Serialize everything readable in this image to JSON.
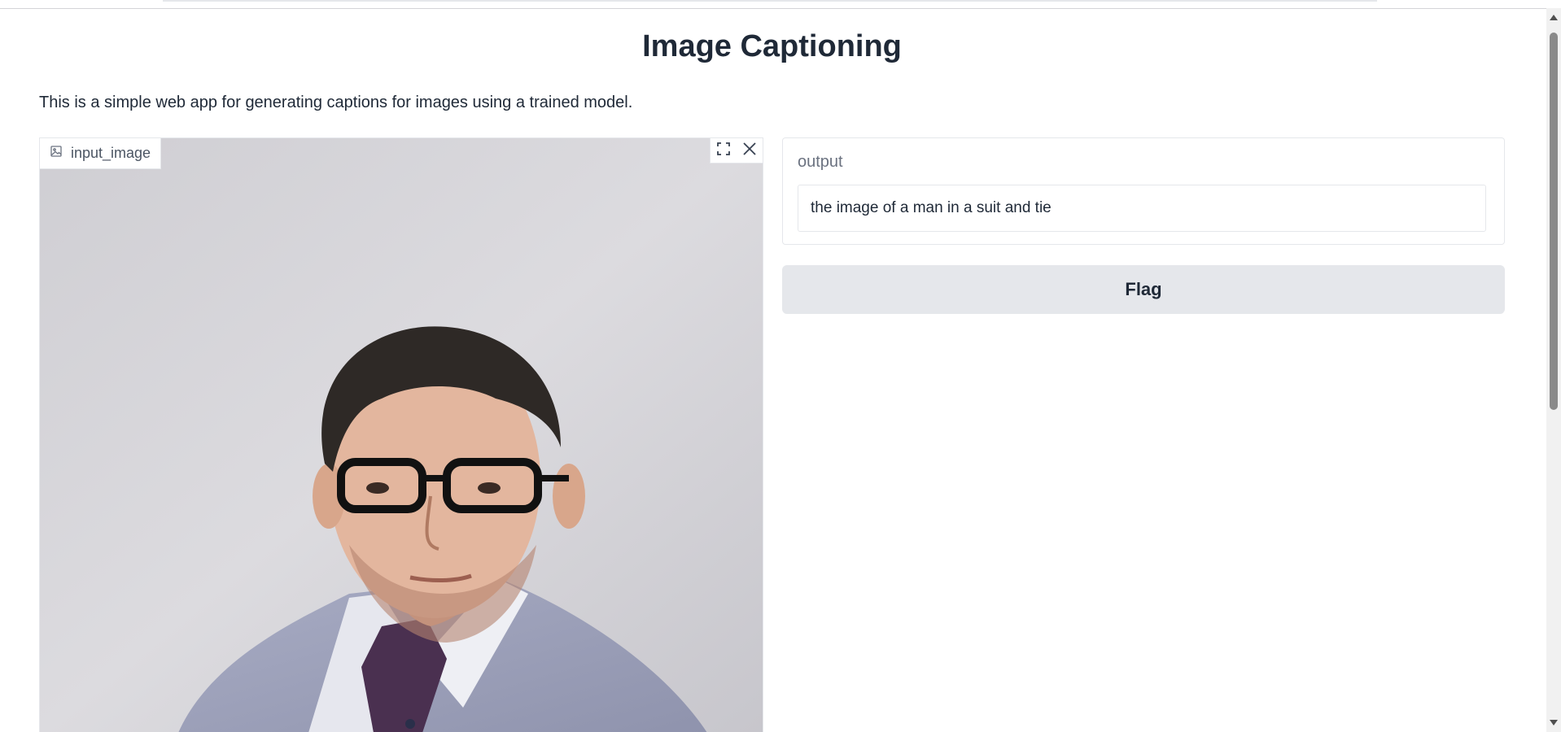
{
  "app": {
    "title": "Image Captioning",
    "description": "This is a simple web app for generating captions for images using a trained model."
  },
  "input_image": {
    "label": "input_image",
    "label_icon": "image-icon",
    "tools": [
      {
        "name": "fullscreen",
        "icon": "expand-icon"
      },
      {
        "name": "clear",
        "icon": "close-icon"
      }
    ]
  },
  "output": {
    "label": "output",
    "value": "the image of a man in a suit and tie"
  },
  "actions": {
    "flag_label": "Flag"
  },
  "colors": {
    "button_bg": "#e5e7eb",
    "border": "#e5e7eb",
    "text": "#1f2937",
    "muted": "#6b7280"
  }
}
